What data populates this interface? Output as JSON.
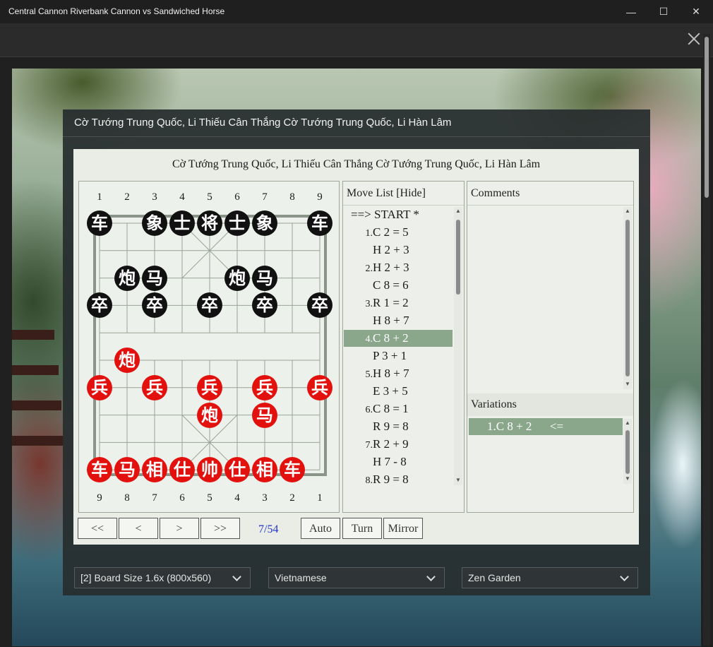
{
  "window": {
    "title": "Central Cannon Riverbank Cannon vs Sandwiched Horse",
    "min": "—",
    "max": "☐",
    "close": "✕"
  },
  "dialog": {
    "title": "Cờ Tướng Trung Quốc, Li Thiếu Cân Thắng Cờ Tướng Trung Quốc, Li Hàn Lâm"
  },
  "game": {
    "heading": "Cờ Tướng Trung Quốc, Li Thiếu Cân Thắng Cờ Tướng Trung Quốc, Li Hàn Lâm"
  },
  "board": {
    "top_files": [
      "1",
      "2",
      "3",
      "4",
      "5",
      "6",
      "7",
      "8",
      "9"
    ],
    "bottom_files": [
      "9",
      "8",
      "7",
      "6",
      "5",
      "4",
      "3",
      "2",
      "1"
    ],
    "pieces": [
      {
        "c": "b",
        "ch": "车",
        "f": 0,
        "r": 0
      },
      {
        "c": "b",
        "ch": "象",
        "f": 2,
        "r": 0
      },
      {
        "c": "b",
        "ch": "士",
        "f": 3,
        "r": 0
      },
      {
        "c": "b",
        "ch": "将",
        "f": 4,
        "r": 0
      },
      {
        "c": "b",
        "ch": "士",
        "f": 5,
        "r": 0
      },
      {
        "c": "b",
        "ch": "象",
        "f": 6,
        "r": 0
      },
      {
        "c": "b",
        "ch": "车",
        "f": 8,
        "r": 0
      },
      {
        "c": "b",
        "ch": "炮",
        "f": 1,
        "r": 2
      },
      {
        "c": "b",
        "ch": "马",
        "f": 2,
        "r": 2
      },
      {
        "c": "b",
        "ch": "炮",
        "f": 5,
        "r": 2
      },
      {
        "c": "b",
        "ch": "马",
        "f": 6,
        "r": 2
      },
      {
        "c": "b",
        "ch": "卒",
        "f": 0,
        "r": 3
      },
      {
        "c": "b",
        "ch": "卒",
        "f": 2,
        "r": 3
      },
      {
        "c": "b",
        "ch": "卒",
        "f": 4,
        "r": 3
      },
      {
        "c": "b",
        "ch": "卒",
        "f": 6,
        "r": 3
      },
      {
        "c": "b",
        "ch": "卒",
        "f": 8,
        "r": 3
      },
      {
        "c": "r",
        "ch": "炮",
        "f": 1,
        "r": 5
      },
      {
        "c": "r",
        "ch": "兵",
        "f": 0,
        "r": 6
      },
      {
        "c": "r",
        "ch": "兵",
        "f": 2,
        "r": 6
      },
      {
        "c": "r",
        "ch": "兵",
        "f": 4,
        "r": 6
      },
      {
        "c": "r",
        "ch": "兵",
        "f": 6,
        "r": 6
      },
      {
        "c": "r",
        "ch": "兵",
        "f": 8,
        "r": 6
      },
      {
        "c": "r",
        "ch": "炮",
        "f": 4,
        "r": 7
      },
      {
        "c": "r",
        "ch": "马",
        "f": 6,
        "r": 7
      },
      {
        "c": "r",
        "ch": "车",
        "f": 0,
        "r": 9
      },
      {
        "c": "r",
        "ch": "马",
        "f": 1,
        "r": 9
      },
      {
        "c": "r",
        "ch": "相",
        "f": 2,
        "r": 9
      },
      {
        "c": "r",
        "ch": "仕",
        "f": 3,
        "r": 9
      },
      {
        "c": "r",
        "ch": "帅",
        "f": 4,
        "r": 9
      },
      {
        "c": "r",
        "ch": "仕",
        "f": 5,
        "r": 9
      },
      {
        "c": "r",
        "ch": "相",
        "f": 6,
        "r": 9
      },
      {
        "c": "r",
        "ch": "车",
        "f": 7,
        "r": 9
      }
    ]
  },
  "move_list": {
    "header": "Move List [Hide]",
    "rows": [
      {
        "num": "",
        "move": "==> START *"
      },
      {
        "num": "1.",
        "move": "C 2 = 5"
      },
      {
        "num": "",
        "move": "H 2 + 3"
      },
      {
        "num": "2.",
        "move": "H 2 + 3"
      },
      {
        "num": "",
        "move": "C 8 = 6"
      },
      {
        "num": "3.",
        "move": "R 1 = 2"
      },
      {
        "num": "",
        "move": "H 8 + 7"
      },
      {
        "num": "4.",
        "move": "C 8 + 2"
      },
      {
        "num": "",
        "move": "P 3 + 1"
      },
      {
        "num": "5.",
        "move": "H 8 + 7"
      },
      {
        "num": "",
        "move": "E 3 + 5"
      },
      {
        "num": "6.",
        "move": "C 8 = 1"
      },
      {
        "num": "",
        "move": "R 9 = 8"
      },
      {
        "num": "7.",
        "move": "R 2 + 9"
      },
      {
        "num": "",
        "move": "H 7 - 8"
      },
      {
        "num": "8.",
        "move": "R 9 = 8"
      }
    ],
    "selected_index": 7
  },
  "comments": {
    "header": "Comments"
  },
  "variations": {
    "header": "Variations",
    "row": "1.C 8 + 2      <="
  },
  "nav": {
    "first": "<<",
    "prev": "<",
    "next": ">",
    "last": ">>",
    "counter": "7/54",
    "auto": "Auto",
    "turn": "Turn",
    "mirror": "Mirror"
  },
  "selects": {
    "board_size": "[2] Board Size 1.6x (800x560)",
    "language": "Vietnamese",
    "theme": "Zen Garden"
  },
  "colors": {
    "red_piece": "#e3110e",
    "black_piece": "#111111",
    "selection": "#8aa78c"
  }
}
